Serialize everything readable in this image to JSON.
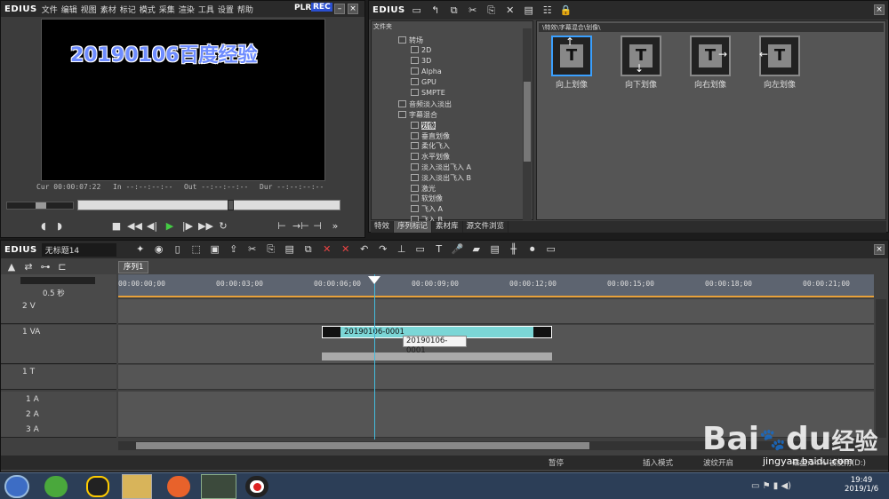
{
  "player": {
    "logo": "EDIUS",
    "menu": [
      "文件",
      "编辑",
      "视图",
      "素材",
      "标记",
      "模式",
      "采集",
      "渲染",
      "工具",
      "设置",
      "帮助"
    ],
    "plr": "PLR",
    "rec": "REC",
    "preview_text": "20190106百度经验",
    "cur_label": "Cur",
    "cur_value": "00:00:07:22",
    "in_label": "In",
    "in_value": "--:--:--:--",
    "out_label": "Out",
    "out_value": "--:--:--:--",
    "dur_label": "Dur",
    "dur_value": "--:--:--:--"
  },
  "effects": {
    "logo": "EDIUS",
    "folder_header": "文件夹",
    "path": "\\特效\\字幕混合\\划像\\",
    "tree": [
      {
        "label": "转场",
        "indent": 1
      },
      {
        "label": "2D",
        "indent": 2
      },
      {
        "label": "3D",
        "indent": 2
      },
      {
        "label": "Alpha",
        "indent": 2
      },
      {
        "label": "GPU",
        "indent": 2
      },
      {
        "label": "SMPTE",
        "indent": 2
      },
      {
        "label": "音频淡入淡出",
        "indent": 1
      },
      {
        "label": "字幕混合",
        "indent": 1
      },
      {
        "label": "划像",
        "indent": 2
      },
      {
        "label": "垂直划像",
        "indent": 2
      },
      {
        "label": "柔化飞入",
        "indent": 2
      },
      {
        "label": "水平划像",
        "indent": 2
      },
      {
        "label": "淡入淡出飞入 A",
        "indent": 2
      },
      {
        "label": "淡入淡出飞入 B",
        "indent": 2
      },
      {
        "label": "激光",
        "indent": 2
      },
      {
        "label": "软划像",
        "indent": 2
      },
      {
        "label": "飞入 A",
        "indent": 2
      },
      {
        "label": "飞入 B",
        "indent": 2
      }
    ],
    "tabs": [
      "特效",
      "序列标记",
      "素材库",
      "源文件浏览"
    ],
    "thumbs": [
      {
        "label": "向上划像",
        "arrow": "↑"
      },
      {
        "label": "向下划像",
        "arrow": "↓"
      },
      {
        "label": "向右划像",
        "arrow": "→"
      },
      {
        "label": "向左划像",
        "arrow": "←"
      }
    ]
  },
  "timeline": {
    "logo": "EDIUS",
    "project": "无标题14",
    "sequence_tab": "序列1",
    "zoom": "0.5 秒",
    "ruler": [
      "00:00:00;00",
      "00:00:03;00",
      "00:00:06;00",
      "00:00:09;00",
      "00:00:12;00",
      "00:00:15;00",
      "00:00:18;00",
      "00:00:21;00"
    ],
    "tracks": [
      "2 V",
      "1 VA",
      "1 T",
      "1 A",
      "2 A",
      "3 A"
    ],
    "clip_name": "20190106-0001",
    "tooltip": "20190106-0001"
  },
  "status": {
    "pause": "暂停",
    "insert_mode": "插入模式",
    "ripple": "波纹开启",
    "disk": "磁盘:54% 被使用(D:)"
  },
  "taskbar": {
    "time": "19:49",
    "date": "2019/1/6"
  },
  "watermark": {
    "brand": "Bai",
    "brand2": "du",
    "jy": "经验",
    "url": "jingyan.baidu.com"
  }
}
